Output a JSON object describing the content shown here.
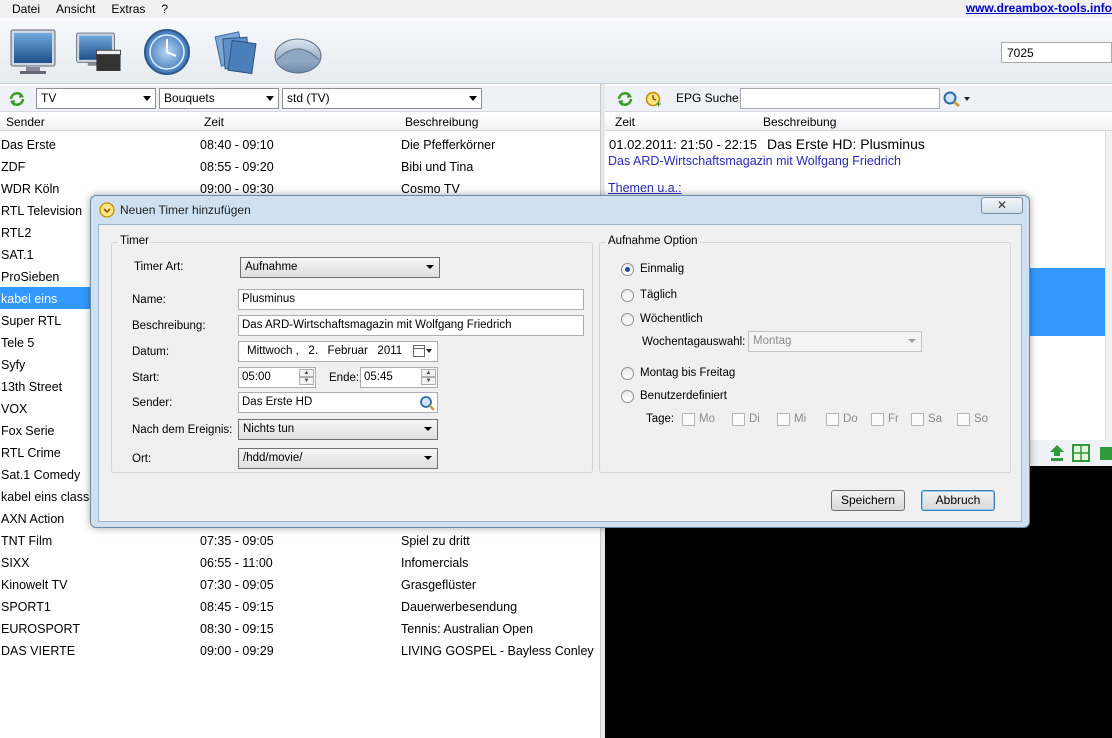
{
  "menu": {
    "items": [
      "Datei",
      "Ansicht",
      "Extras",
      "?"
    ],
    "link": "www.dreambox-tools.info"
  },
  "toolbar": {
    "icons": [
      "tv-icon",
      "movie-icon",
      "clock-icon",
      "bouquet-icon",
      "satellite-dish-icon"
    ],
    "model_combo": "7025"
  },
  "left_panel": {
    "filter1": "TV",
    "filter2": "Bouquets",
    "filter3": "std (TV)",
    "columns": [
      "Sender",
      "Zeit",
      "Beschreibung"
    ],
    "rows": [
      {
        "sender": "Das Erste",
        "zeit": "08:40 - 09:10",
        "beschreibung": "Die Pfefferkörner"
      },
      {
        "sender": "ZDF",
        "zeit": "08:55 - 09:20",
        "beschreibung": "Bibi und Tina"
      },
      {
        "sender": "WDR Köln",
        "zeit": "09:00 - 09:30",
        "beschreibung": "Cosmo TV"
      },
      {
        "sender": "RTL Television",
        "zeit": "",
        "beschreibung": ""
      },
      {
        "sender": "RTL2",
        "zeit": "",
        "beschreibung": ""
      },
      {
        "sender": "SAT.1",
        "zeit": "",
        "beschreibung": ""
      },
      {
        "sender": "ProSieben",
        "zeit": "",
        "beschreibung": ""
      },
      {
        "sender": "kabel eins",
        "zeit": "",
        "beschreibung": "",
        "selected": true
      },
      {
        "sender": "Super RTL",
        "zeit": "",
        "beschreibung": ""
      },
      {
        "sender": "Tele 5",
        "zeit": "",
        "beschreibung": ""
      },
      {
        "sender": "Syfy",
        "zeit": "",
        "beschreibung": ""
      },
      {
        "sender": "13th Street",
        "zeit": "",
        "beschreibung": ""
      },
      {
        "sender": "VOX",
        "zeit": "",
        "beschreibung": ""
      },
      {
        "sender": "Fox Serie",
        "zeit": "",
        "beschreibung": ""
      },
      {
        "sender": "RTL Crime",
        "zeit": "",
        "beschreibung": ""
      },
      {
        "sender": "Sat.1 Comedy",
        "zeit": "",
        "beschreibung": ""
      },
      {
        "sender": "kabel eins classics",
        "zeit": "",
        "beschreibung": ""
      },
      {
        "sender": "AXN Action",
        "zeit": "",
        "beschreibung": ""
      },
      {
        "sender": "TNT Film",
        "zeit": "07:35 - 09:05",
        "beschreibung": "Spiel zu dritt"
      },
      {
        "sender": "SIXX",
        "zeit": "06:55 - 11:00",
        "beschreibung": "Infomercials"
      },
      {
        "sender": "Kinowelt TV",
        "zeit": "07:30 - 09:05",
        "beschreibung": "Grasgeflüster"
      },
      {
        "sender": "SPORT1",
        "zeit": "08:45 - 09:15",
        "beschreibung": "Dauerwerbesendung"
      },
      {
        "sender": "EUROSPORT",
        "zeit": "08:30 - 09:15",
        "beschreibung": "Tennis: Australian Open"
      },
      {
        "sender": "DAS VIERTE",
        "zeit": "09:00 - 09:29",
        "beschreibung": "LIVING GOSPEL - Bayless Conley"
      }
    ]
  },
  "right_panel": {
    "epg_label": "EPG Suche:",
    "epg_value": "",
    "columns": [
      "Zeit",
      "Beschreibung"
    ],
    "entry_time": "01.02.2011: 21:50 - 22:15",
    "entry_title": "Das Erste HD: Plusminus",
    "entry_desc": "Das ARD-Wirtschaftsmagazin mit Wolfgang Friedrich",
    "entry_more": "Themen u.a.:"
  },
  "dialog": {
    "title": "Neuen Timer hinzufügen",
    "close": "✕",
    "timer_group": "Timer",
    "timer_art_label": "Timer Art:",
    "timer_art": "Aufnahme",
    "name_label": "Name:",
    "name": "Plusminus",
    "beschreibung_label": "Beschreibung:",
    "beschreibung": "Das ARD-Wirtschaftsmagazin mit Wolfgang Friedrich",
    "datum_label": "Datum:",
    "datum_weekday": "Mittwoch",
    "datum_day": "2.",
    "datum_month": "Februar",
    "datum_year": "2011",
    "start_label": "Start:",
    "start": "05:00",
    "ende_label": "Ende:",
    "ende": "05:45",
    "sender_label": "Sender:",
    "sender": "Das Erste HD",
    "nach_label": "Nach dem Ereignis:",
    "nach": "Nichts tun",
    "ort_label": "Ort:",
    "ort": "/hdd/movie/",
    "option_group": "Aufnahme Option",
    "opt_einmalig": "Einmalig",
    "opt_taeglich": "Täglich",
    "opt_woechentlich": "Wöchentlich",
    "wochentag_label": "Wochentagauswahl:",
    "wochentag": "Montag",
    "opt_mo_fr": "Montag bis Freitag",
    "opt_benutzer": "Benutzerdefiniert",
    "tage_label": "Tage:",
    "days": [
      "Mo",
      "Di",
      "Mi",
      "Do",
      "Fr",
      "Sa",
      "So"
    ],
    "save": "Speichern",
    "cancel": "Abbruch"
  }
}
